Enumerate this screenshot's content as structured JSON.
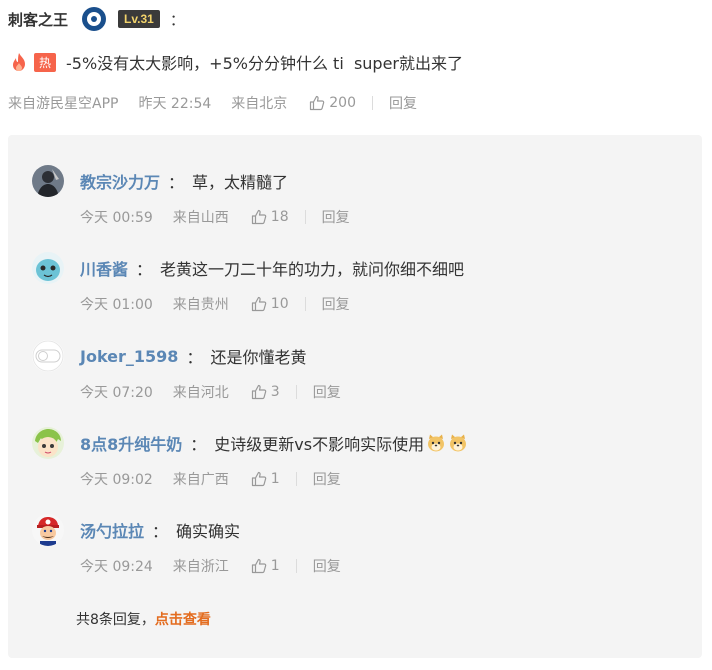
{
  "comment": {
    "username": "刺客之王",
    "level": "Lv.31",
    "colon": "：",
    "hot_label": "热",
    "text": "-5%没有太大影响，+5%分分钟什么 ti  super就出来了",
    "source": "来自游民星空APP",
    "time": "昨天 22:54",
    "location": "来自北京",
    "likes": "200",
    "reply_label": "回复"
  },
  "replies": [
    {
      "username": "教宗沙力万",
      "colon": "：",
      "text": "草，太精髓了",
      "time": "今天 00:59",
      "location": "来自山西",
      "likes": "18",
      "reply_label": "回复"
    },
    {
      "username": "川香酱",
      "colon": "：",
      "text": "老黄这一刀二十年的功力，就问你细不细吧",
      "time": "今天 01:00",
      "location": "来自贵州",
      "likes": "10",
      "reply_label": "回复"
    },
    {
      "username": "Joker_1598",
      "colon": "：",
      "text": "还是你懂老黄",
      "time": "今天 07:20",
      "location": "来自河北",
      "likes": "3",
      "reply_label": "回复"
    },
    {
      "username": "8点8升纯牛奶",
      "colon": "：",
      "text": "史诗级更新vs不影响实际使用",
      "time": "今天 09:02",
      "location": "来自广西",
      "likes": "1",
      "reply_label": "回复"
    },
    {
      "username": "汤勺拉拉",
      "colon": "：",
      "text": "确实确实",
      "time": "今天 09:24",
      "location": "来自浙江",
      "likes": "1",
      "reply_label": "回复"
    }
  ],
  "footer": {
    "total_text": "共8条回复，",
    "view_link": "点击查看"
  }
}
